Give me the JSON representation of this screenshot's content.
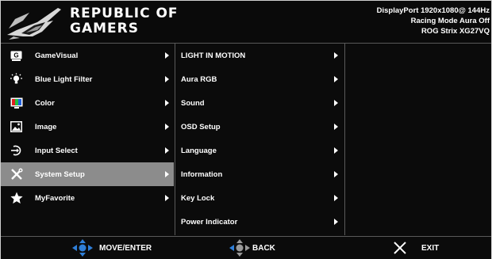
{
  "header": {
    "brand_line1": "REPUBLIC OF",
    "brand_line2": "GAMERS",
    "status_line1": "DisplayPort  1920x1080@  144Hz",
    "status_line2": "Racing Mode Aura Off",
    "status_line3": "ROG Strix XG27VQ"
  },
  "main_menu": [
    {
      "label": "GameVisual",
      "icon": "gamevisual-icon"
    },
    {
      "label": "Blue Light Filter",
      "icon": "bulb-icon"
    },
    {
      "label": "Color",
      "icon": "color-icon"
    },
    {
      "label": "Image",
      "icon": "image-icon"
    },
    {
      "label": "Input Select",
      "icon": "input-icon"
    },
    {
      "label": "System Setup",
      "icon": "wrench-screwdriver-icon",
      "selected": true
    },
    {
      "label": "MyFavorite",
      "icon": "star-icon"
    }
  ],
  "sub_menu": [
    {
      "label": "LIGHT IN MOTION"
    },
    {
      "label": "Aura RGB"
    },
    {
      "label": "Sound"
    },
    {
      "label": "OSD Setup"
    },
    {
      "label": "Language"
    },
    {
      "label": "Information"
    },
    {
      "label": "Key Lock"
    },
    {
      "label": "Power Indicator"
    }
  ],
  "footer": {
    "move_enter": "MOVE/ENTER",
    "back": "BACK",
    "exit": "EXIT"
  },
  "colors": {
    "accent_blue": "#2f7fd8",
    "selected_bg": "#8c8c8c"
  }
}
